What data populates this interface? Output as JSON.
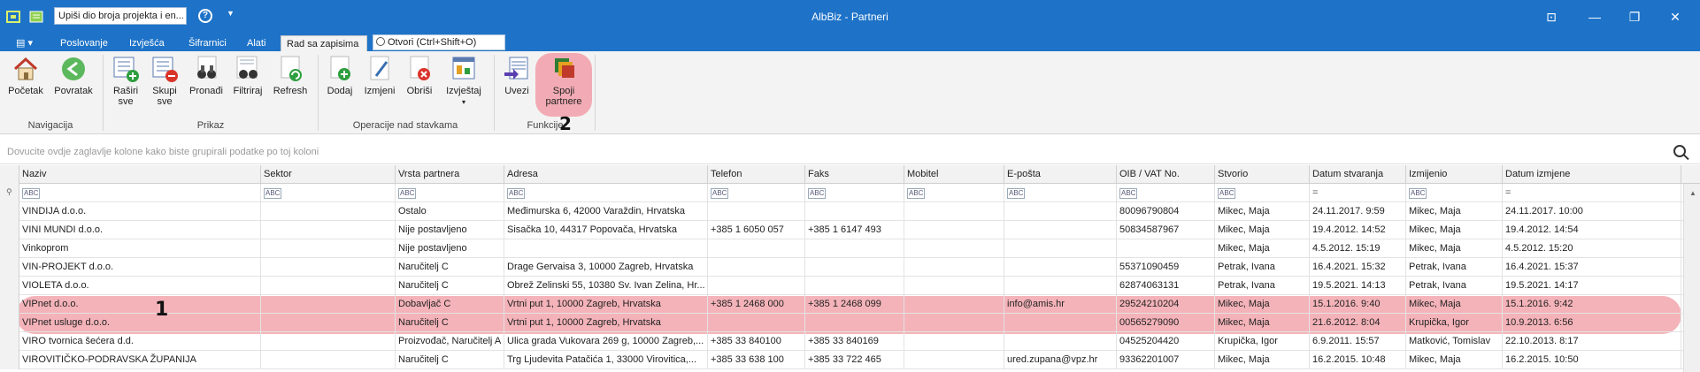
{
  "window": {
    "title": "AlbBiz - Partneri"
  },
  "quick_search": {
    "value": "Upiši dio broja projekta i en..."
  },
  "tabs": [
    {
      "label": "Poslovanje"
    },
    {
      "label": "Izvješća"
    },
    {
      "label": "Šifrarnici"
    },
    {
      "label": "Alati"
    },
    {
      "label": "Rad sa zapisima"
    }
  ],
  "otvori": {
    "label": "Otvori (Ctrl+Shift+O)"
  },
  "ribbon": {
    "buttons": {
      "pocetak": "Početak",
      "povratak": "Povratak",
      "rasiri_1": "Raširi",
      "rasiri_2": "sve",
      "skupi_1": "Skupi",
      "skupi_2": "sve",
      "pronadi": "Pronađi",
      "filtriraj": "Filtriraj",
      "refresh": "Refresh",
      "dodaj": "Dodaj",
      "izmjeni": "Izmjeni",
      "obrisi": "Obriši",
      "izvjestaj": "Izvještaj",
      "uvezi": "Uvezi",
      "spoji_1": "Spoji",
      "spoji_2": "partnere"
    },
    "groups": {
      "navigacija": "Navigacija",
      "prikaz": "Prikaz",
      "operacije": "Operacije nad stavkama",
      "funkcije": "Funkcije"
    }
  },
  "annotations": {
    "one": "1",
    "two": "2"
  },
  "group_panel": {
    "hint": "Dovucite ovdje zaglavlje kolone kako biste grupirali podatke po toj koloni"
  },
  "grid": {
    "columns": [
      "Naziv",
      "Sektor",
      "Vrsta partnera",
      "Adresa",
      "Telefon",
      "Faks",
      "Mobitel",
      "E-pošta",
      "OIB / VAT No.",
      "Stvorio",
      "Datum stvaranja",
      "Izmijenio",
      "Datum izmjene"
    ],
    "filter_abc": "ABC",
    "filter_eq": "=",
    "rows": [
      [
        "VINDIJA d.o.o.",
        "",
        "Ostalo",
        "Međimurska 6, 42000 Varaždin, Hrvatska",
        "",
        "",
        "",
        "",
        "80096790804",
        "Mikec, Maja",
        "24.11.2017. 9:59",
        "Mikec, Maja",
        "24.11.2017. 10:00"
      ],
      [
        "VINI MUNDI d.o.o.",
        "",
        "Nije postavljeno",
        "Sisačka 10, 44317 Popovača, Hrvatska",
        "+385 1 6050 057",
        "+385 1 6147 493",
        "",
        "",
        "50834587967",
        "Mikec, Maja",
        "19.4.2012. 14:52",
        "Mikec, Maja",
        "19.4.2012. 14:54"
      ],
      [
        "Vinkoprom",
        "",
        "Nije postavljeno",
        "",
        "",
        "",
        "",
        "",
        "",
        "Mikec, Maja",
        "4.5.2012. 15:19",
        "Mikec, Maja",
        "4.5.2012. 15:20"
      ],
      [
        "VIN-PROJEKT d.o.o.",
        "",
        "Naručitelj C",
        "Drage Gervaisa 3, 10000 Zagreb, Hrvatska",
        "",
        "",
        "",
        "",
        "55371090459",
        "Petrak, Ivana",
        "16.4.2021. 15:32",
        "Petrak, Ivana",
        "16.4.2021. 15:37"
      ],
      [
        "VIOLETA d.o.o.",
        "",
        "Naručitelj C",
        "Obrež Zelinski 55, 10380 Sv. Ivan Zelina, Hr...",
        "",
        "",
        "",
        "",
        "62874063131",
        "Petrak, Ivana",
        "19.5.2021. 14:13",
        "Petrak, Ivana",
        "19.5.2021. 14:17"
      ],
      [
        "VIPnet d.o.o.",
        "",
        "Dobavljač C",
        "Vrtni put 1, 10000 Zagreb, Hrvatska",
        "+385 1 2468  000",
        "+385 1 2468 099",
        "",
        "info@amis.hr",
        "29524210204",
        "Mikec, Maja",
        "15.1.2016. 9:40",
        "Mikec, Maja",
        "15.1.2016. 9:42"
      ],
      [
        "VIPnet usluge d.o.o.",
        "",
        "Naručitelj C",
        "Vrtni put 1, 10000 Zagreb, Hrvatska",
        "",
        "",
        "",
        "",
        "00565279090",
        "Mikec, Maja",
        "21.6.2012. 8:04",
        "Krupička, Igor",
        "10.9.2013. 6:56"
      ],
      [
        "VIRO tvornica šećera d.d.",
        "",
        "Proizvođač, Naručitelj A",
        "Ulica grada Vukovara 269 g, 10000 Zagreb,...",
        "+385 33 840100",
        "+385 33 840169",
        "",
        "",
        "04525204420",
        "Krupička, Igor",
        "6.9.2011. 15:57",
        "Matković, Tomislav",
        "22.10.2013. 8:17"
      ],
      [
        "VIROVITIČKO-PODRAVSKA ŽUPANIJA",
        "",
        "Naručitelj C",
        "Trg Ljudevita Patačića 1, 33000 Virovitica,...",
        "+385 33 638 100",
        "+385 33 722 465",
        "",
        "ured.zupana@vpz.hr",
        "93362201007",
        "Mikec, Maja",
        "16.2.2015. 10:48",
        "Mikec, Maja",
        "16.2.2015. 10:50"
      ]
    ]
  },
  "colors": {
    "titlebar": "#1e73c8",
    "highlight": "#f4b3b9"
  }
}
